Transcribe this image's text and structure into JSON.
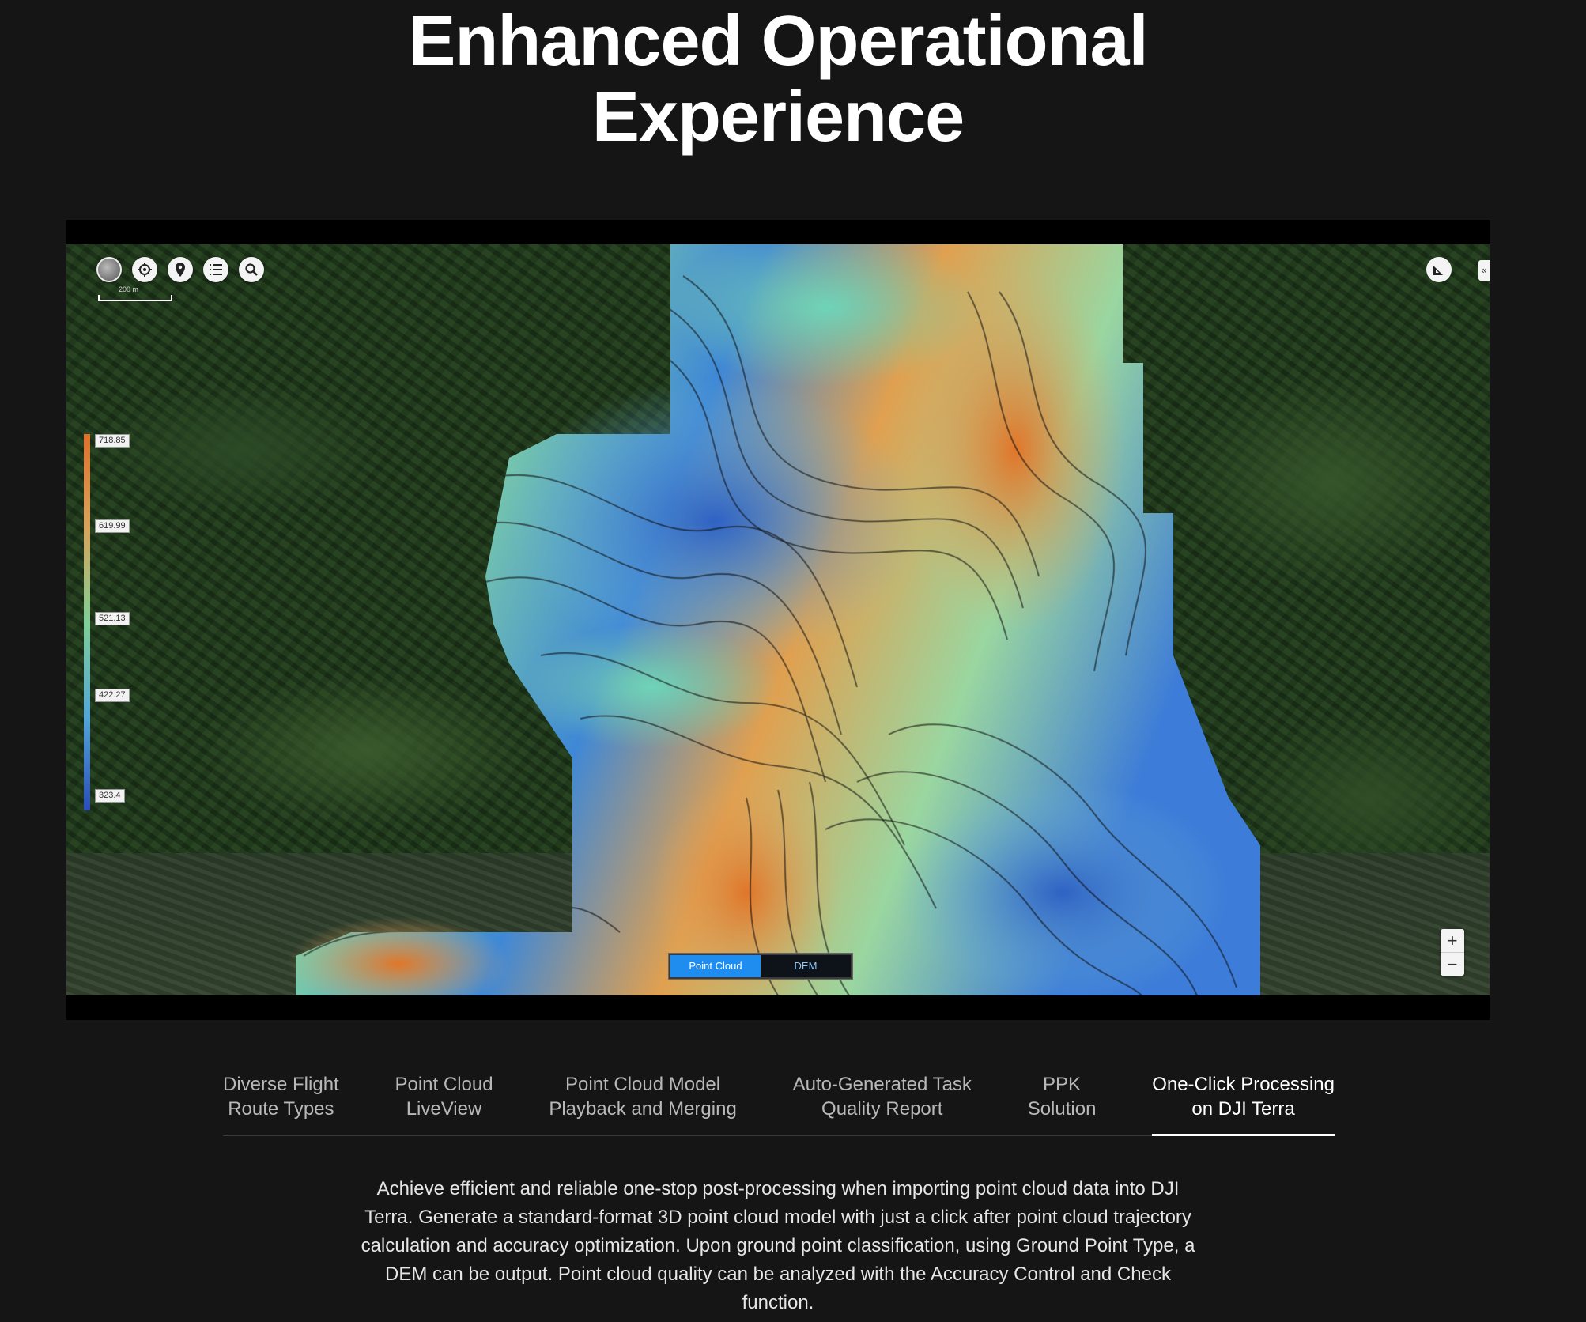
{
  "page": {
    "title_line1": "Enhanced Operational",
    "title_line2": "Experience"
  },
  "viewer": {
    "scale_label": "200 m",
    "legend": [
      "718.85",
      "619.99",
      "521.13",
      "422.27",
      "323.4"
    ],
    "toggle": {
      "point_cloud": "Point Cloud",
      "dem": "DEM"
    },
    "zoom": {
      "in": "+",
      "out": "−"
    },
    "collapse": "«",
    "icons": [
      "globe-icon",
      "locate-icon",
      "pin-icon",
      "list-icon",
      "search-icon",
      "measure-icon"
    ]
  },
  "tabs": [
    {
      "line1": "Diverse Flight",
      "line2": "Route Types"
    },
    {
      "line1": "Point Cloud",
      "line2": "LiveView"
    },
    {
      "line1": "Point Cloud Model",
      "line2": "Playback and Merging"
    },
    {
      "line1": "Auto-Generated Task",
      "line2": "Quality Report"
    },
    {
      "line1": "PPK",
      "line2": "Solution"
    },
    {
      "line1": "One-Click Processing",
      "line2": "on DJI Terra"
    }
  ],
  "active_tab": "One-Click Processing on DJI Terra",
  "description": "Achieve efficient and reliable one-stop post-processing when importing point cloud data into DJI Terra. Generate a standard-format 3D point cloud model with just a click after point cloud trajectory calculation and accuracy optimization. Upon ground point classification, using Ground Point Type, a DEM can be output. Point cloud quality can be analyzed with the Accuracy Control and Check function."
}
